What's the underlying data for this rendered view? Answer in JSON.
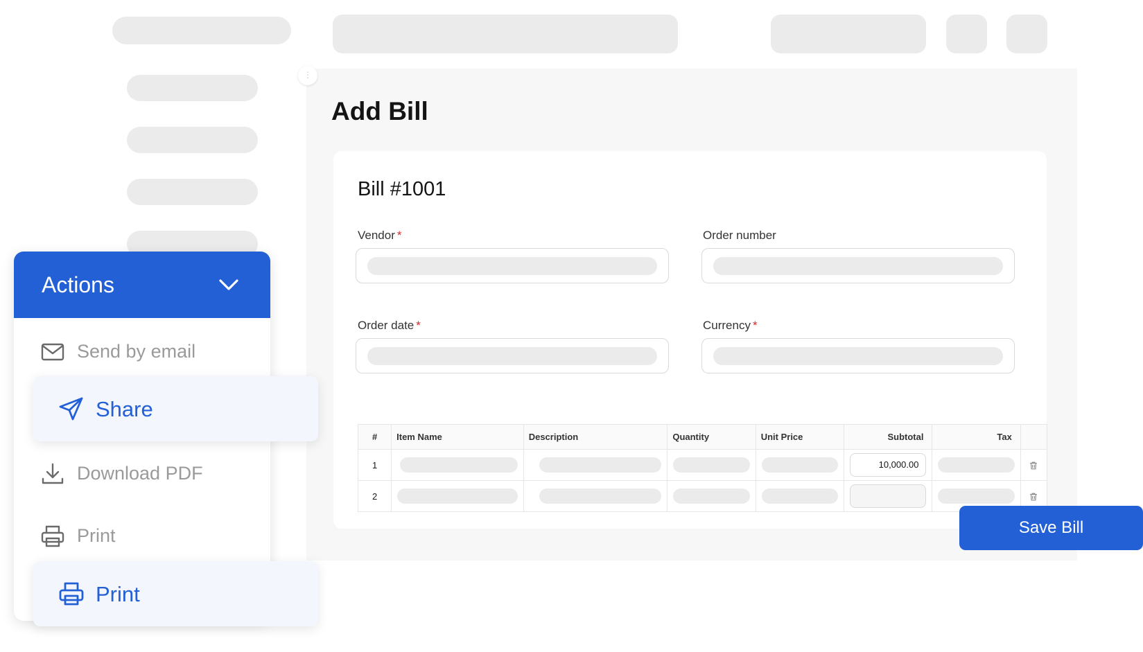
{
  "page": {
    "title": "Add Bill",
    "collapse_glyph": "⋮"
  },
  "bill": {
    "title": "Bill #1001",
    "required_mark": "*",
    "fields": {
      "vendor": {
        "label": "Vendor",
        "required": true
      },
      "order_number": {
        "label": "Order number",
        "required": false
      },
      "order_date": {
        "label": "Order date",
        "required": true
      },
      "currency": {
        "label": "Currency",
        "required": true
      }
    }
  },
  "table": {
    "headers": {
      "num": "#",
      "item_name": "Item Name",
      "description": "Description",
      "quantity": "Quantity",
      "unit_price": "Unit Price",
      "subtotal": "Subtotal",
      "tax": "Tax"
    },
    "rows": [
      {
        "num": "1",
        "subtotal": "10,000.00"
      },
      {
        "num": "2",
        "subtotal": ""
      }
    ]
  },
  "save_button": {
    "label": "Save Bill"
  },
  "actions": {
    "title": "Actions",
    "items": [
      {
        "label": "Send by email",
        "icon": "mail-icon",
        "highlighted": false
      },
      {
        "label": "Share",
        "icon": "send-icon",
        "highlighted": true
      },
      {
        "label": "Download PDF",
        "icon": "download-icon",
        "highlighted": false
      },
      {
        "label": "Print",
        "icon": "printer-icon",
        "highlighted": false
      },
      {
        "label": "Print",
        "icon": "printer-icon",
        "highlighted": true
      }
    ]
  },
  "colors": {
    "primary": "#2360d6",
    "placeholder": "#ebebeb",
    "required": "#d62828",
    "muted_text": "#9a9a9a"
  }
}
